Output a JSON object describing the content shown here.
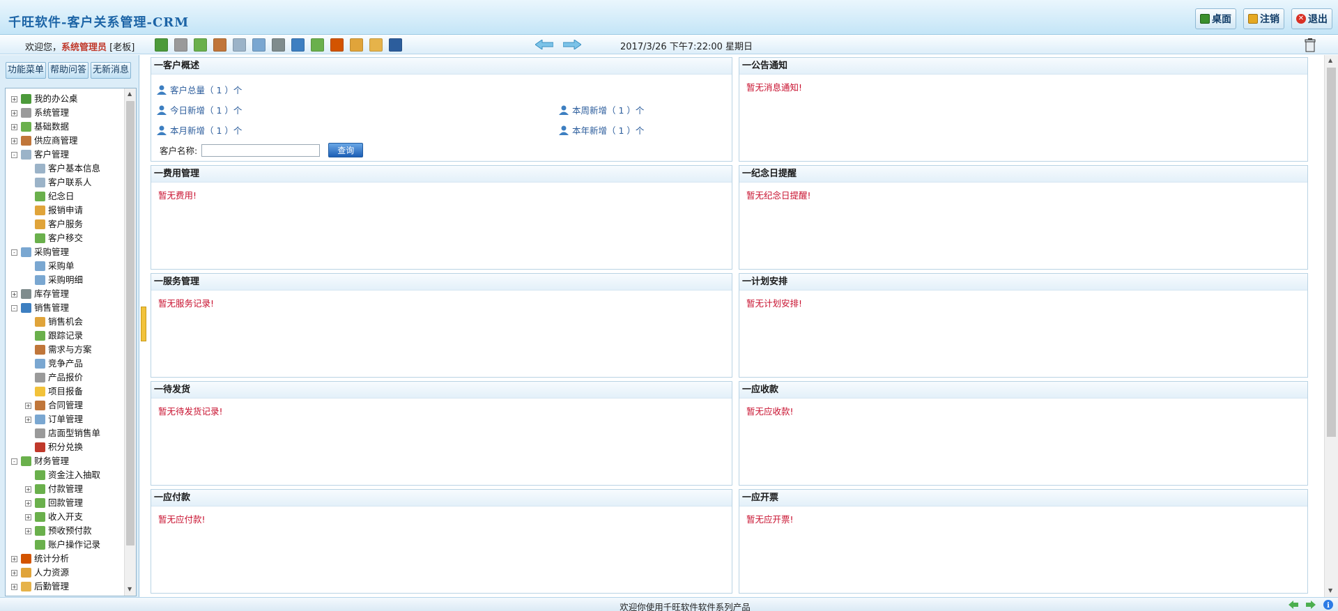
{
  "header": {
    "title": "千旺软件-客户关系管理-CRM",
    "buttons": [
      {
        "label": "桌面",
        "icon": "desktop-icon",
        "color": "#3a8f2d"
      },
      {
        "label": "注销",
        "icon": "logoff-icon",
        "color": "#e5a821"
      },
      {
        "label": "退出",
        "icon": "exit-icon",
        "color": "#d93025"
      }
    ]
  },
  "toolbar": {
    "welcome_prefix": "欢迎您，",
    "user_role": "系统管理员",
    "user_name": "[老板]",
    "icons": [
      {
        "name": "office-icon",
        "color": "#4c9a3a"
      },
      {
        "name": "gear-icon",
        "color": "#9a9a9a"
      },
      {
        "name": "data-icon",
        "color": "#6ab04c"
      },
      {
        "name": "supplier-icon",
        "color": "#c0763a"
      },
      {
        "name": "customer-card-icon",
        "color": "#9bb3c8"
      },
      {
        "name": "purchase-icon",
        "color": "#7aa7d1"
      },
      {
        "name": "warehouse-icon",
        "color": "#7f8c8d"
      },
      {
        "name": "sales-icon",
        "color": "#3d7fc1"
      },
      {
        "name": "finance-icon",
        "color": "#6ab04c"
      },
      {
        "name": "statistics-icon",
        "color": "#d35400"
      },
      {
        "name": "hr-icon",
        "color": "#e0a43a"
      },
      {
        "name": "logistics-icon",
        "color": "#e6b34a"
      },
      {
        "name": "bank-icon",
        "color": "#2c5d9c"
      }
    ],
    "datetime": "2017/3/26 下午7:22:00 星期日"
  },
  "sidebar": {
    "tabs": [
      "功能菜单",
      "帮助问答",
      "无新消息"
    ],
    "tree": [
      {
        "label": "我的办公桌",
        "level": 0,
        "toggle": "+",
        "icon": "desk-icon",
        "color": "#4c9a3a"
      },
      {
        "label": "系统管理",
        "level": 0,
        "toggle": "+",
        "icon": "gear-icon",
        "color": "#9a9a9a"
      },
      {
        "label": "基础数据",
        "level": 0,
        "toggle": "+",
        "icon": "data-icon",
        "color": "#6ab04c"
      },
      {
        "label": "供应商管理",
        "level": 0,
        "toggle": "+",
        "icon": "supplier-icon",
        "color": "#c0763a"
      },
      {
        "label": "客户管理",
        "level": 0,
        "toggle": "-",
        "icon": "customer-icon",
        "color": "#9bb3c8"
      },
      {
        "label": "客户基本信息",
        "level": 1,
        "toggle": "",
        "icon": "card-icon",
        "color": "#9bb3c8"
      },
      {
        "label": "客户联系人",
        "level": 1,
        "toggle": "",
        "icon": "contact-icon",
        "color": "#9bb3c8"
      },
      {
        "label": "纪念日",
        "level": 1,
        "toggle": "",
        "icon": "anniversary-icon",
        "color": "#6ab04c"
      },
      {
        "label": "报销申请",
        "level": 1,
        "toggle": "",
        "icon": "reimburse-icon",
        "color": "#e0a43a"
      },
      {
        "label": "客户服务",
        "level": 1,
        "toggle": "",
        "icon": "service-icon",
        "color": "#e0a43a"
      },
      {
        "label": "客户移交",
        "level": 1,
        "toggle": "",
        "icon": "transfer-icon",
        "color": "#6ab04c"
      },
      {
        "label": "采购管理",
        "level": 0,
        "toggle": "-",
        "icon": "purchase-icon",
        "color": "#7aa7d1"
      },
      {
        "label": "采购单",
        "level": 1,
        "toggle": "",
        "icon": "document-icon",
        "color": "#7aa7d1"
      },
      {
        "label": "采购明细",
        "level": 1,
        "toggle": "",
        "icon": "document-icon",
        "color": "#7aa7d1"
      },
      {
        "label": "库存管理",
        "level": 0,
        "toggle": "+",
        "icon": "warehouse-icon",
        "color": "#7f8c8d"
      },
      {
        "label": "销售管理",
        "level": 0,
        "toggle": "-",
        "icon": "sales-icon",
        "color": "#3d7fc1"
      },
      {
        "label": "销售机会",
        "level": 1,
        "toggle": "",
        "icon": "opportunity-icon",
        "color": "#e0a43a"
      },
      {
        "label": "跟踪记录",
        "level": 1,
        "toggle": "",
        "icon": "track-icon",
        "color": "#6ab04c"
      },
      {
        "label": "需求与方案",
        "level": 1,
        "toggle": "",
        "icon": "person-icon",
        "color": "#c0763a"
      },
      {
        "label": "竞争产品",
        "level": 1,
        "toggle": "",
        "icon": "compete-icon",
        "color": "#7aa7d1"
      },
      {
        "label": "产品报价",
        "level": 1,
        "toggle": "",
        "icon": "quote-icon",
        "color": "#9a9a9a"
      },
      {
        "label": "项目报备",
        "level": 1,
        "toggle": "",
        "icon": "coin-icon",
        "color": "#f2c23a"
      },
      {
        "label": "合同管理",
        "level": 1,
        "toggle": "+",
        "icon": "contract-icon",
        "color": "#c0763a"
      },
      {
        "label": "订单管理",
        "level": 1,
        "toggle": "+",
        "icon": "order-icon",
        "color": "#7aa7d1"
      },
      {
        "label": "店面型销售单",
        "level": 1,
        "toggle": "",
        "icon": "document-icon",
        "color": "#9a9a9a"
      },
      {
        "label": "积分兑换",
        "level": 1,
        "toggle": "",
        "icon": "star-icon",
        "color": "#c0392b"
      },
      {
        "label": "财务管理",
        "level": 0,
        "toggle": "-",
        "icon": "finance-icon",
        "color": "#6ab04c"
      },
      {
        "label": "资金注入抽取",
        "level": 1,
        "toggle": "",
        "icon": "money-icon",
        "color": "#6ab04c"
      },
      {
        "label": "付款管理",
        "level": 1,
        "toggle": "+",
        "icon": "money-icon",
        "color": "#6ab04c"
      },
      {
        "label": "回款管理",
        "level": 1,
        "toggle": "+",
        "icon": "money-icon",
        "color": "#6ab04c"
      },
      {
        "label": "收入开支",
        "level": 1,
        "toggle": "+",
        "icon": "money-icon",
        "color": "#6ab04c"
      },
      {
        "label": "预收预付款",
        "level": 1,
        "toggle": "+",
        "icon": "money-icon",
        "color": "#6ab04c"
      },
      {
        "label": "账户操作记录",
        "level": 1,
        "toggle": "",
        "icon": "money-icon",
        "color": "#6ab04c"
      },
      {
        "label": "统计分析",
        "level": 0,
        "toggle": "+",
        "icon": "statistics-icon",
        "color": "#d35400"
      },
      {
        "label": "人力资源",
        "level": 0,
        "toggle": "+",
        "icon": "hr-icon",
        "color": "#e0a43a"
      },
      {
        "label": "后勤管理",
        "level": 0,
        "toggle": "+",
        "icon": "logistics-icon",
        "color": "#e6b34a"
      }
    ]
  },
  "panels": {
    "customer_overview": {
      "title": "一客户概述",
      "total": "客户总量（ 1 ）个",
      "today": "今日新增（ 1 ）个",
      "week": "本周新增（ 1 ）个",
      "month": "本月新增（ 1 ）个",
      "year": "本年新增（ 1 ）个",
      "search_label": "客户名称:",
      "search_value": "",
      "search_button": "查询"
    },
    "notice": {
      "title": "一公告通知",
      "empty": "暂无消息通知!"
    },
    "expense": {
      "title": "一费用管理",
      "empty": "暂无费用!"
    },
    "anniversary": {
      "title": "一纪念日提醒",
      "empty": "暂无纪念日提醒!"
    },
    "service": {
      "title": "一服务管理",
      "empty": "暂无服务记录!"
    },
    "plan": {
      "title": "一计划安排",
      "empty": "暂无计划安排!"
    },
    "pending_ship": {
      "title": "一待发货",
      "empty": "暂无待发货记录!"
    },
    "receivable": {
      "title": "一应收款",
      "empty": "暂无应收款!"
    },
    "payable": {
      "title": "一应付款",
      "empty": "暂无应付款!"
    },
    "invoice": {
      "title": "一应开票",
      "empty": "暂无应开票!"
    }
  },
  "statusbar": {
    "text": "欢迎你使用千旺软件软件系列产品",
    "icons": [
      "back-arrow-icon",
      "forward-arrow-icon",
      "info-icon"
    ]
  },
  "colors": {
    "accent": "#1c64a6",
    "empty_text": "#c8102e",
    "link": "#2c5d9c",
    "role": "#c0392b"
  }
}
